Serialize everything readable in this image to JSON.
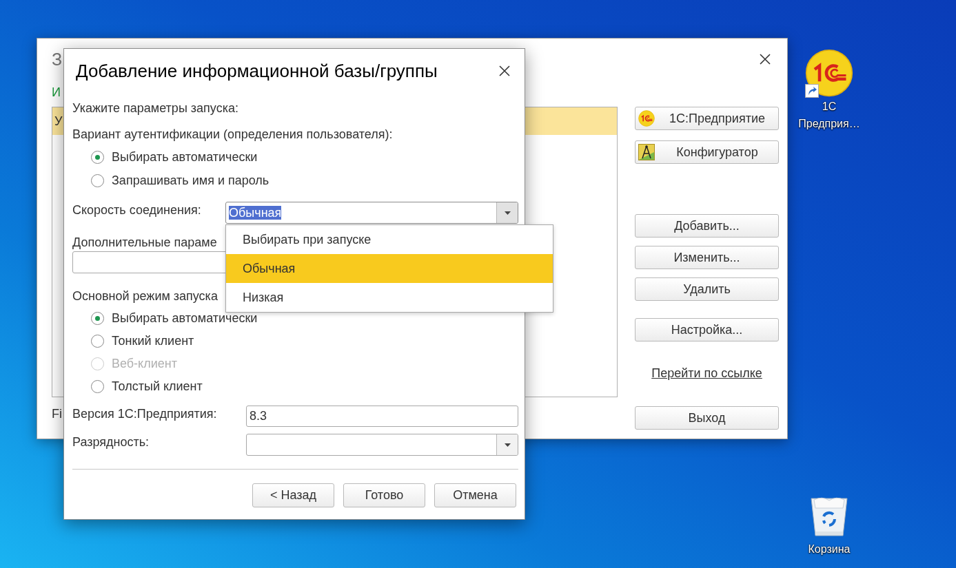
{
  "desktop": {
    "icons": [
      {
        "kind": "app",
        "label_lines": [
          "1С",
          "Предприя…"
        ]
      },
      {
        "kind": "recycle_bin",
        "label_lines": [
          "Корзина"
        ]
      }
    ]
  },
  "back_window": {
    "title": "З",
    "list_caption": "И",
    "list_rows": [
      {
        "text": "У",
        "selected": true
      }
    ],
    "footer": "Fi",
    "launch_buttons": [
      "1С:Предприятие",
      "Конфигуратор"
    ],
    "edit_buttons": [
      "Добавить...",
      "Изменить...",
      "Удалить"
    ],
    "settings_button": "Настройка...",
    "link": "Перейти по ссылке",
    "exit_button": "Выход"
  },
  "dialog": {
    "title": "Добавление информационной базы/группы",
    "intro": "Укажите параметры запуска:",
    "auth": {
      "label": "Вариант аутентификации (определения пользователя):",
      "options": [
        {
          "label": "Выбирать автоматически",
          "selected": true,
          "disabled": false
        },
        {
          "label": "Запрашивать имя и пароль",
          "selected": false,
          "disabled": false
        }
      ]
    },
    "speed": {
      "label": "Скорость соединения:",
      "value": "Обычная",
      "value_highlighted": true,
      "expanded": true,
      "options": [
        {
          "label": "Выбирать при запуске",
          "selected": false
        },
        {
          "label": "Обычная",
          "selected": true
        },
        {
          "label": "Низкая",
          "selected": false
        }
      ]
    },
    "extra_params": {
      "label": "Дополнительные параме"
    },
    "mode": {
      "label": "Основной режим запуска",
      "options": [
        {
          "label": "Выбирать автоматически",
          "selected": true,
          "disabled": false
        },
        {
          "label": "Тонкий клиент",
          "selected": false,
          "disabled": false
        },
        {
          "label": "Веб-клиент",
          "selected": false,
          "disabled": true
        },
        {
          "label": "Толстый клиент",
          "selected": false,
          "disabled": false
        }
      ]
    },
    "version": {
      "label": "Версия 1С:Предприятия:",
      "value": "8.3"
    },
    "bitness": {
      "label": "Разрядность:"
    },
    "buttons": [
      "< Назад",
      "Готово",
      "Отмена"
    ]
  }
}
